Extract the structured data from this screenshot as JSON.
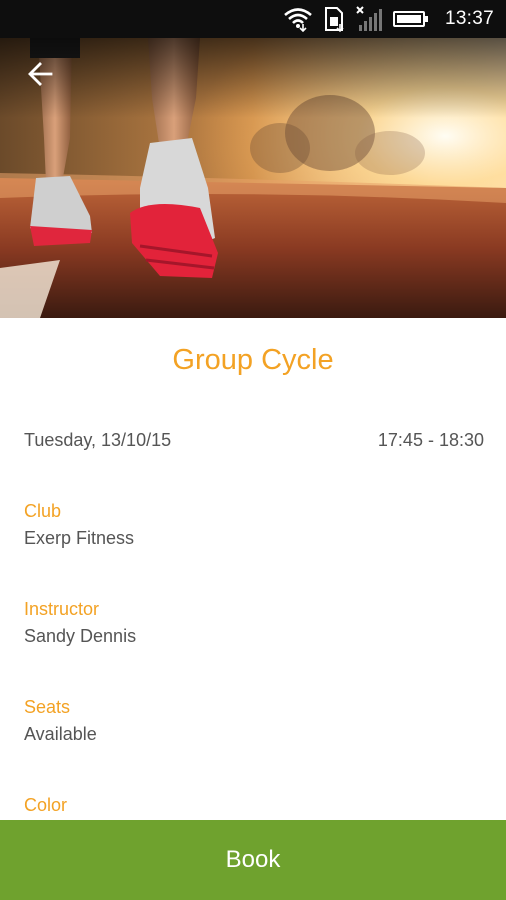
{
  "status_bar": {
    "time": "13:37",
    "icons": [
      "wifi-icon",
      "sim-card-icon",
      "signal-off-icon",
      "battery-icon"
    ]
  },
  "header": {
    "back_icon": "arrow-left-icon"
  },
  "hero_image": {
    "description_icon": "running-shoes-photo"
  },
  "class_detail": {
    "title": "Group Cycle",
    "date": "Tuesday, 13/10/15",
    "time_range": "17:45 - 18:30",
    "fields": {
      "club": {
        "label": "Club",
        "value": "Exerp Fitness"
      },
      "instructor": {
        "label": "Instructor",
        "value": "Sandy Dennis"
      },
      "seats": {
        "label": "Seats",
        "value": "Available"
      },
      "color": {
        "label": "Color"
      }
    }
  },
  "actions": {
    "book_label": "Book"
  },
  "colors": {
    "accent": "#f3a224",
    "book_bar": "#6fa22e",
    "text": "#555555",
    "status_bar": "#0e0e0e"
  }
}
